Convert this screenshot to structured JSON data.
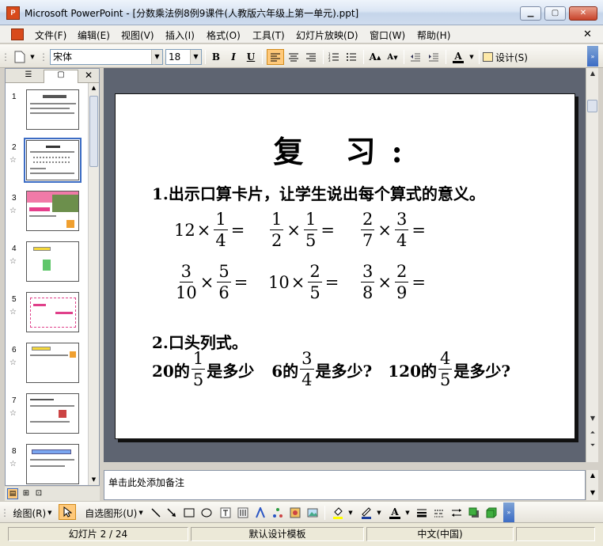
{
  "window": {
    "title": "Microsoft PowerPoint - [分数乘法例8例9课件(人教版六年级上第一单元).ppt]",
    "app_icon": "P"
  },
  "menu": [
    "文件(F)",
    "编辑(E)",
    "视图(V)",
    "插入(I)",
    "格式(O)",
    "工具(T)",
    "幻灯片放映(D)",
    "窗口(W)",
    "帮助(H)"
  ],
  "toolbar": {
    "font_name": "宋体",
    "font_size": "18",
    "bold": "B",
    "italic": "I",
    "underline": "U",
    "font_color": "A",
    "design_label": "设计(S)"
  },
  "slides_pane": {
    "numbers": [
      "1",
      "2",
      "3",
      "4",
      "5",
      "6",
      "7",
      "8"
    ],
    "selected_index": 1
  },
  "slide": {
    "heading": "复 习:",
    "line1": "1.出示口算卡片，让学生说出每个算式的意义。",
    "line2": "2.口头列式。",
    "expr": {
      "e1": {
        "whole": "12",
        "n": "1",
        "d": "4"
      },
      "e2": {
        "n1": "1",
        "d1": "2",
        "n2": "1",
        "d2": "5"
      },
      "e3": {
        "n1": "2",
        "d1": "7",
        "n2": "3",
        "d2": "4"
      },
      "e4": {
        "n1": "3",
        "d1": "10",
        "n2": "5",
        "d2": "6"
      },
      "e5": {
        "whole": "10",
        "n": "2",
        "d": "5"
      },
      "e6": {
        "n1": "3",
        "d1": "8",
        "n2": "2",
        "d2": "9"
      },
      "times": "×",
      "equals": "="
    },
    "row3": {
      "a_pre": "20的",
      "a_n": "1",
      "a_d": "5",
      "a_post": "是多少",
      "b_pre": "6的",
      "b_n": "3",
      "b_d": "4",
      "b_post": "是多少?",
      "c_pre": "120的",
      "c_n": "4",
      "c_d": "5",
      "c_post": "是多少?"
    }
  },
  "notes": {
    "placeholder": "单击此处添加备注"
  },
  "drawing": {
    "draw_label": "绘图(R)",
    "autoshapes_label": "自选图形(U)"
  },
  "status": {
    "slide_info": "幻灯片 2 / 24",
    "template": "默认设计模板",
    "language": "中文(中国)"
  },
  "colors": {
    "accent": "#3c6cc4",
    "workspace": "#5e6471"
  }
}
